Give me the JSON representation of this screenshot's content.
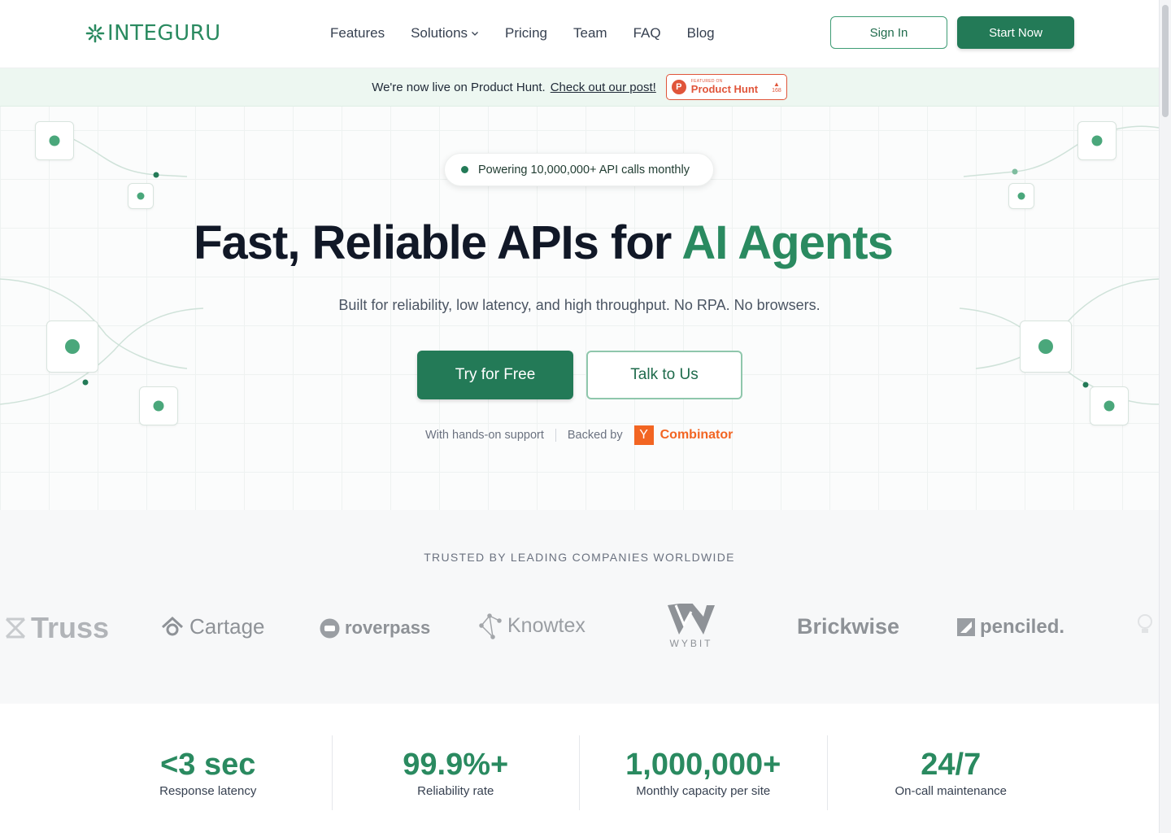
{
  "brand": {
    "name": "INTEGURU",
    "accent": "#2a8a60",
    "dark_accent": "#237a57"
  },
  "nav": {
    "items": [
      {
        "label": "Features"
      },
      {
        "label": "Solutions",
        "has_dropdown": true
      },
      {
        "label": "Pricing"
      },
      {
        "label": "Team"
      },
      {
        "label": "FAQ"
      },
      {
        "label": "Blog"
      }
    ],
    "sign_in": "Sign In",
    "start_now": "Start Now"
  },
  "banner": {
    "text": "We're now live on Product Hunt.",
    "link": "Check out our post!",
    "product_hunt": {
      "featured_on": "FEATURED ON",
      "name": "Product Hunt",
      "upvotes": "168",
      "color": "#e0553a"
    }
  },
  "hero": {
    "pill": "Powering 10,000,000+ API calls monthly",
    "title_main": "Fast, Reliable APIs for ",
    "title_accent": "AI Agents",
    "subtitle": "Built for reliability, low latency, and high throughput. No RPA. No browsers.",
    "cta_primary": "Try for Free",
    "cta_secondary": "Talk to Us",
    "support_text": "With hands-on support",
    "backed_by": "Backed by",
    "yc_letter": "Y",
    "yc_name": "Combinator"
  },
  "trusted": {
    "title": "TRUSTED BY LEADING COMPANIES WORLDWIDE",
    "companies": [
      {
        "name": "Truss",
        "icon": "truss-icon"
      },
      {
        "name": "Cartage",
        "icon": "cartage-icon"
      },
      {
        "name": "roverpass",
        "icon": "roverpass-icon"
      },
      {
        "name": "Knowtex",
        "icon": "knowtex-icon"
      },
      {
        "name": "WYBIT",
        "icon": "wybit-icon"
      },
      {
        "name": "Brickwise",
        "icon": ""
      },
      {
        "name": "penciled.",
        "icon": "penciled-icon"
      }
    ]
  },
  "stats": [
    {
      "value": "<3 sec",
      "label": "Response latency"
    },
    {
      "value": "99.9%+",
      "label": "Reliability rate"
    },
    {
      "value": "1,000,000+",
      "label": "Monthly capacity per site"
    },
    {
      "value": "24/7",
      "label": "On-call maintenance"
    }
  ]
}
